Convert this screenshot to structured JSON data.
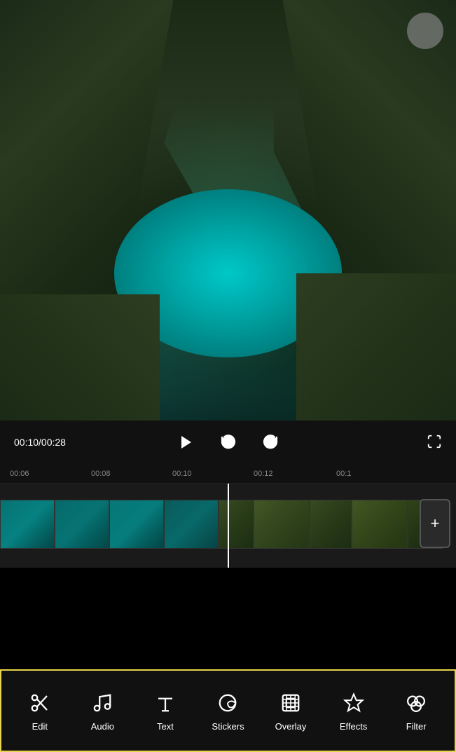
{
  "video": {
    "current_time": "00:10",
    "total_time": "00:28",
    "time_display": "00:10/00:28"
  },
  "timeline": {
    "markers": [
      "00:06",
      "00:08",
      "00:10",
      "00:12",
      "00:1"
    ]
  },
  "toolbar": {
    "items": [
      {
        "id": "edit",
        "label": "Edit",
        "icon": "scissors"
      },
      {
        "id": "audio",
        "label": "Audio",
        "icon": "music-note"
      },
      {
        "id": "text",
        "label": "Text",
        "icon": "text-t"
      },
      {
        "id": "stickers",
        "label": "Stickers",
        "icon": "sticker"
      },
      {
        "id": "overlay",
        "label": "Overlay",
        "icon": "overlay-grid"
      },
      {
        "id": "effects",
        "label": "Effects",
        "icon": "star-effects"
      },
      {
        "id": "filter",
        "label": "Filter",
        "icon": "filter-loop"
      }
    ]
  },
  "colors": {
    "toolbar_border": "#e8d44d",
    "playhead": "#ffffff",
    "background": "#111111"
  }
}
